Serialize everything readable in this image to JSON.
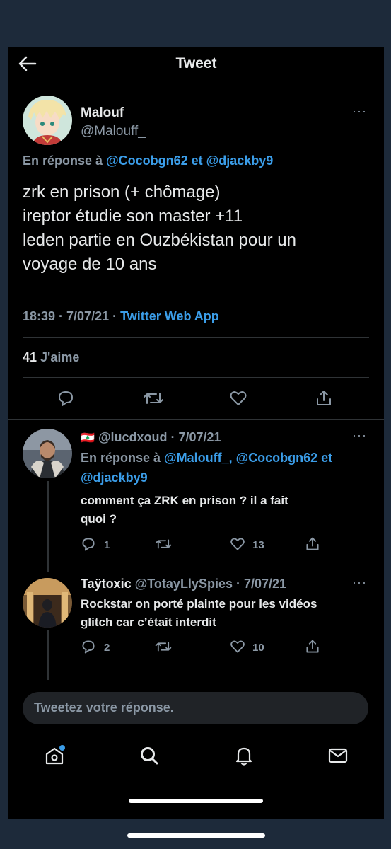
{
  "header": {
    "title": "Tweet",
    "back_icon": "arrow-left-icon"
  },
  "main_tweet": {
    "name": "Malouf",
    "handle": "@Malouff_",
    "reply_prefix": "En réponse à",
    "reply_user1": "@Cocobgn62",
    "reply_and": "et",
    "reply_user2": "@djackby9",
    "text_lines": [
      "zrk en prison (+ chômage)",
      "ireptor étudie son master +11",
      "leden partie en Ouzbékistan pour un",
      "voyage de 10 ans"
    ],
    "time": "18:39 · 7/07/21 ·",
    "source": "Twitter Web App",
    "likes_count": "41",
    "likes_label": "J'aime",
    "more": "···"
  },
  "replies": [
    {
      "flag": "🇱🇧",
      "handle": "@lucdxoud",
      "date": "· 7/07/21",
      "reply_prefix": "En réponse à",
      "reply_users_line1": "@Malouff_, @Cocobgn62 et",
      "reply_users_line2": "@djackby9",
      "text_line1": "comment ça ZRK en prison ? il a fait",
      "text_line2": "quoi ?",
      "reply_count": "1",
      "like_count": "13",
      "more": "···"
    },
    {
      "name": "Taÿtoxic",
      "handle": "@TotayLlySpies",
      "date": "· 7/07/21",
      "text_line1": "Rockstar on porté plainte pour les vidéos",
      "text_line2": "glitch car c’était interdit",
      "reply_count": "2",
      "like_count": "10",
      "more": "···"
    }
  ],
  "compose": {
    "placeholder": "Tweetez votre réponse."
  },
  "bottom_nav": [
    "home-icon",
    "search-icon",
    "bell-icon",
    "mail-icon"
  ],
  "colors": {
    "accent": "#3b9de8",
    "background": "#000000",
    "muted": "#8b98a5"
  }
}
